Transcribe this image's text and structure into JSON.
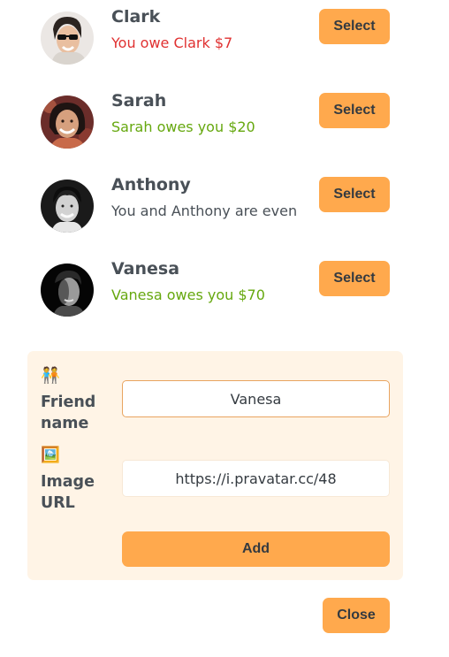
{
  "friends": [
    {
      "name": "Clark",
      "status": "You owe Clark $7",
      "status_type": "owe",
      "select_label": "Select"
    },
    {
      "name": "Sarah",
      "status": "Sarah owes you $20",
      "status_type": "owed",
      "select_label": "Select"
    },
    {
      "name": "Anthony",
      "status": "You and Anthony are even",
      "status_type": "even",
      "select_label": "Select"
    },
    {
      "name": "Vanesa",
      "status": "Vanesa owes you $70",
      "status_type": "owed",
      "select_label": "Select"
    }
  ],
  "form": {
    "name_emoji": "🧑‍🤝‍🧑",
    "name_label": "Friend name",
    "name_value": "Vanesa",
    "image_emoji": "🖼️",
    "image_label": "Image URL",
    "image_value": "https://i.pravatar.cc/48",
    "add_label": "Add"
  },
  "close_label": "Close",
  "colors": {
    "accent": "#ffa94d",
    "panel": "#fff4e6",
    "owe": "#e03131",
    "owed": "#66a80f",
    "text": "#495057"
  }
}
